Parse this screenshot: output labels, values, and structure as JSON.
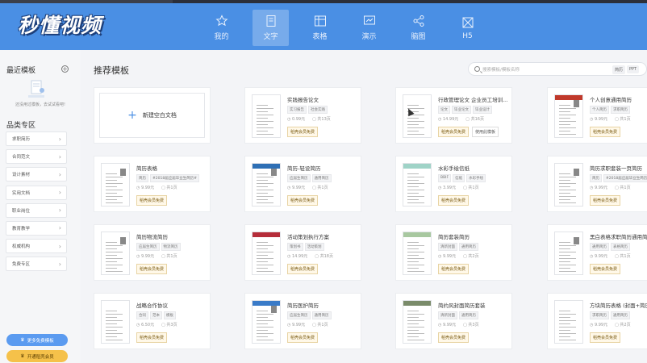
{
  "app": {
    "logo_text": "秒懂视频",
    "nav": [
      {
        "label": "我的",
        "icon": "star-icon"
      },
      {
        "label": "文字",
        "icon": "document-icon"
      },
      {
        "label": "表格",
        "icon": "table-icon"
      },
      {
        "label": "演示",
        "icon": "presentation-icon"
      },
      {
        "label": "脑图",
        "icon": "mindmap-icon"
      },
      {
        "label": "H5",
        "icon": "h5-icon"
      }
    ],
    "active_nav": "文字",
    "accent_color": "#4a8fe4"
  },
  "sidebar": {
    "recent_title": "最近模板",
    "recent_hint": "还没用过模板，去试试看吧!",
    "category_title": "品类专区",
    "categories": [
      "求职简历",
      "合同范文",
      "设计素材",
      "实用文档",
      "职业岗位",
      "教育教学",
      "权威机构",
      "免费专区"
    ],
    "exclusive_button": "更多免费模板",
    "open_member_button": "开通稻壳会员"
  },
  "main": {
    "section_title": "推荐模板",
    "search_placeholder": "搜索模板/模板名称",
    "search_tags": [
      "简历",
      "PPT"
    ],
    "blank_doc_label": "新建空白文档",
    "cards": [
      {
        "title": "实践报告论文",
        "tags": [
          "实习报告",
          "社会实践"
        ],
        "price": "0.99元",
        "pages": "共13页",
        "buttons": [
          "稻壳会员免费"
        ]
      },
      {
        "title": "行政管理论文 企业员工培训...",
        "tags": [
          "论文",
          "毕业论文",
          "毕业设计"
        ],
        "price": "14.99元",
        "pages": "共16页",
        "buttons": [
          "稻壳会员免费",
          "使用此模板"
        ]
      },
      {
        "title": "个人创意通用简历",
        "tags": [
          "个人简历",
          "求职简历"
        ],
        "price": "9.99元",
        "pages": "共1页",
        "buttons": [
          "稻壳会员免费"
        ]
      },
      {
        "title": "简历表格",
        "tags": [
          "简历",
          "#2018届应届毕业生简历#"
        ],
        "price": "9.99元",
        "pages": "共1页",
        "buttons": [
          "稻壳会员免费"
        ]
      },
      {
        "title": "简历-轻设简历",
        "tags": [
          "应届生简历",
          "通用简历"
        ],
        "price": "9.99元",
        "pages": "共1页",
        "buttons": [
          "稻壳会员免费"
        ]
      },
      {
        "title": "水彩手绘信纸",
        "tags": [
          "BBIF",
          "信纸",
          "水彩手绘"
        ],
        "price": "3.99元",
        "pages": "共1页",
        "buttons": [
          "稻壳会员免费"
        ]
      },
      {
        "title": "简历求职套装一页简历",
        "tags": [
          "简历",
          "#2018届应届毕业生简历#"
        ],
        "price": "9.99元",
        "pages": "共1页",
        "buttons": [
          "稻壳会员免费"
        ]
      },
      {
        "title": "简历物流简历",
        "tags": [
          "应届生简历",
          "物流简历"
        ],
        "price": "9.99元",
        "pages": "共1页",
        "buttons": [
          "稻壳会员免费"
        ]
      },
      {
        "title": "活动策划执行方案",
        "tags": [
          "策划书",
          "活动策划"
        ],
        "price": "14.99元",
        "pages": "共18页",
        "buttons": [
          "稻壳会员免费"
        ]
      },
      {
        "title": "简历套装简历",
        "tags": [
          "清新封面",
          "通用简历"
        ],
        "price": "9.99元",
        "pages": "共2页",
        "buttons": [
          "稻壳会员免费"
        ]
      },
      {
        "title": "黑白表格求职简历通用简历",
        "tags": [
          "通用简历",
          "表格简历"
        ],
        "price": "9.99元",
        "pages": "共1页",
        "buttons": [
          "稻壳会员免费"
        ]
      },
      {
        "title": "战略合作协议",
        "tags": [
          "合同",
          "范本",
          "模板"
        ],
        "price": "6.50元",
        "pages": "共3页",
        "buttons": [
          "稻壳会员免费"
        ]
      },
      {
        "title": "简历医护简历",
        "tags": [
          "应届生简历",
          "通用简历"
        ],
        "price": "9.99元",
        "pages": "共1页",
        "buttons": [
          "稻壳会员免费"
        ]
      },
      {
        "title": "简约风封面简历套装",
        "tags": [
          "清新封面",
          "通用简历"
        ],
        "price": "9.99元",
        "pages": "共3页",
        "buttons": [
          "稻壳会员免费"
        ]
      },
      {
        "title": "方块简历表格 (封面+简历)",
        "tags": [
          "求职简历",
          "通用简历"
        ],
        "price": "9.99元",
        "pages": "共2页",
        "buttons": [
          "稻壳会员免费"
        ]
      }
    ]
  }
}
